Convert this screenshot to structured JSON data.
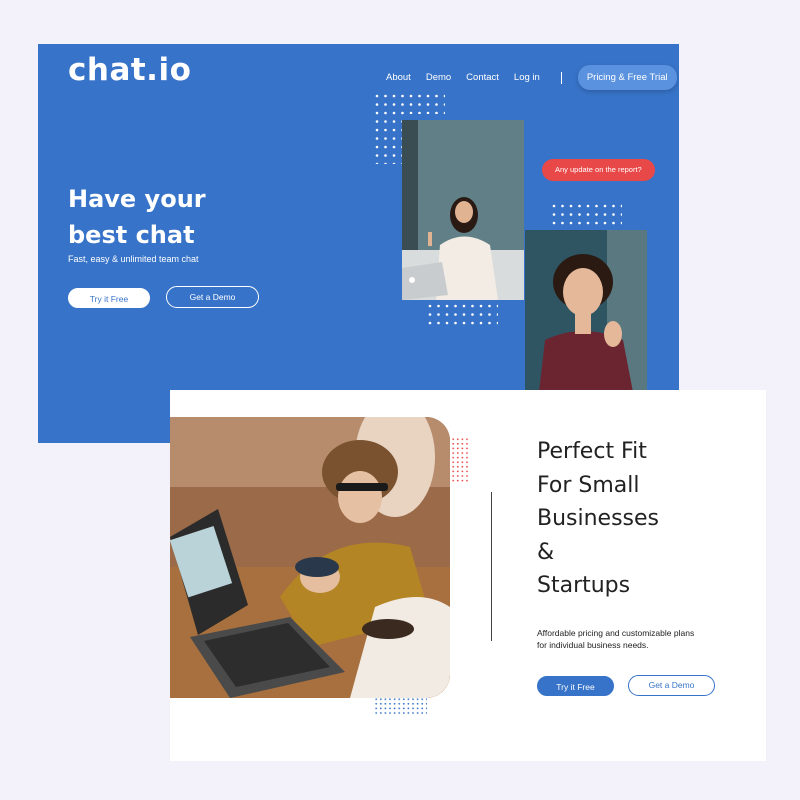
{
  "colors": {
    "page_bg": "#f3f2fb",
    "brand_blue": "#3773c8",
    "accent_red": "#e94848",
    "white": "#ffffff",
    "text_dark": "#222222"
  },
  "hero": {
    "logo": "chat.io",
    "nav": [
      "About",
      "Demo",
      "Contact",
      "Log in"
    ],
    "pricing_cta": "Pricing & Free Trial",
    "title_lines": [
      "Have your",
      "best chat"
    ],
    "subtitle": "Fast, easy & unlimited team chat",
    "try_button": "Try it Free",
    "demo_button": "Get a Demo",
    "chat_bubble": "Any update on the report?"
  },
  "feature": {
    "title_lines": [
      "Perfect Fit",
      "For Small",
      "Businesses",
      "&",
      "Startups"
    ],
    "text_lines": [
      "Affordable pricing and customizable plans",
      "for individual business needs."
    ],
    "try_button": "Try it Free",
    "demo_button": "Get a Demo"
  }
}
